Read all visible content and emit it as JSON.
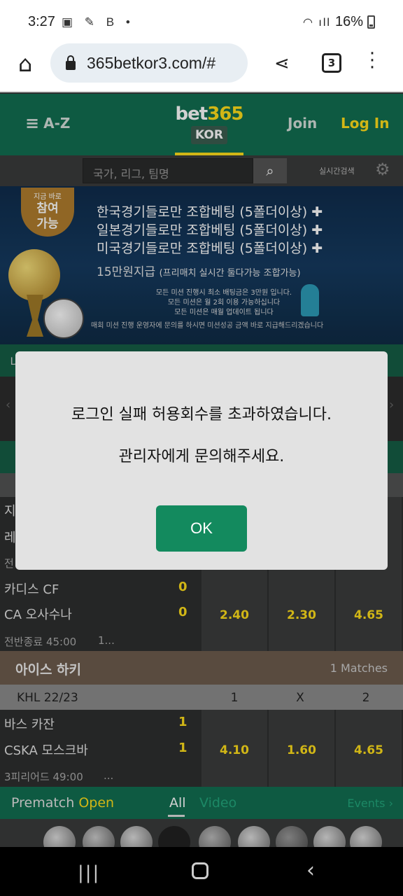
{
  "status_bar": {
    "time": "3:27",
    "icons": "▣ ✎ B •",
    "battery": "16%"
  },
  "browser": {
    "url": "365betkor3.com/#",
    "tab_count": "3"
  },
  "header": {
    "menu_label": "A-Z",
    "logo_main": "bet",
    "logo_accent": "365",
    "logo_sub": "KOR",
    "join": "Join",
    "login": "Log In"
  },
  "search": {
    "placeholder": "국가, 리그, 팀명",
    "live_search": "실시간검색"
  },
  "banner": {
    "ribbon_small": "지금 바로",
    "ribbon_big1": "참여",
    "ribbon_big2": "가능",
    "line1": "한국경기들로만 조합베팅 (5폴더이상) ✚",
    "line2": "일본경기들로만 조합베팅 (5폴더이상) ✚",
    "line3": "미국경기들로만 조합베팅 (5폴더이상) ✚",
    "line4": "15만원지급",
    "line4_small": "(프리매치 실시간 둘다가능 조합가능)",
    "note1": "모든 미션 진행시 최소 배팅금은 3만원 입니다.",
    "note2": "모든 미션은 월 2회 이용 가능하십니다",
    "note3": "모든 미션은 매월 업데이트 됩니다",
    "footer": "매회 미션 진행 운영자에 문의를 하시면 미션성공 금액 바로 지급해드리겠습니다"
  },
  "background_edges": {
    "left_n": "니",
    "left_ji": "지",
    "left_re": "레",
    "left_jeon": "전"
  },
  "matches_soccer": [
    {
      "team1": "카디스 CF",
      "score1": "0",
      "team2": "CA 오사수나",
      "score2": "0",
      "odds": [
        "2.40",
        "2.30",
        "4.65"
      ],
      "status": "전반종료 45:00",
      "more": "1..."
    }
  ],
  "ice_hockey": {
    "title": "아이스 하키",
    "matches_count": "1 Matches",
    "league": "KHL 22/23",
    "col1": "1",
    "colx": "X",
    "col2": "2",
    "team1": "바스 카잔",
    "score1": "1",
    "team2": "CSKA 모스크바",
    "score2": "1",
    "odds": [
      "4.10",
      "1.60",
      "4.65"
    ],
    "status": "3피리어드 49:00",
    "more": "..."
  },
  "bottom_tabs": {
    "prematch": "Prematch",
    "open": "Open",
    "all": "All",
    "video": "Video",
    "events": "Events ›"
  },
  "dialog": {
    "message1": "로그인 실패 허용회수를 초과하였습니다.",
    "message2": "관리자에게 문의해주세요.",
    "ok": "OK"
  },
  "colors": {
    "brand_green": "#126e51",
    "accent_yellow": "#ffdf1b",
    "ok_green": "#138a5e"
  }
}
